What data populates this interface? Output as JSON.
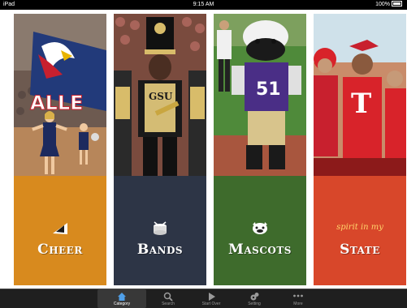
{
  "status": {
    "device": "iPad",
    "time": "9:15 AM",
    "battery": "100%"
  },
  "cards": [
    {
      "label": "Cheer",
      "panel_color": "#d88a1e",
      "icon": "megaphone-icon",
      "banner": "ALLE"
    },
    {
      "label": "Bands",
      "panel_color": "#2d3546",
      "icon": "drum-icon",
      "hat_text": "GSU"
    },
    {
      "label": "Mascots",
      "panel_color": "#3e6b2c",
      "icon": "bulldog-icon",
      "jersey_number": "51"
    },
    {
      "label": "State",
      "panel_color": "#d8472a",
      "icon": "script-text",
      "script": "spirit in my",
      "shirt_letter": "T"
    }
  ],
  "tabs": [
    {
      "label": "Category",
      "icon": "house-icon",
      "active": true
    },
    {
      "label": "Search",
      "icon": "search-icon",
      "active": false
    },
    {
      "label": "Start Over",
      "icon": "play-icon",
      "active": false
    },
    {
      "label": "Setting",
      "icon": "gear-icon",
      "active": false
    },
    {
      "label": "More",
      "icon": "more-icon",
      "active": false
    }
  ]
}
